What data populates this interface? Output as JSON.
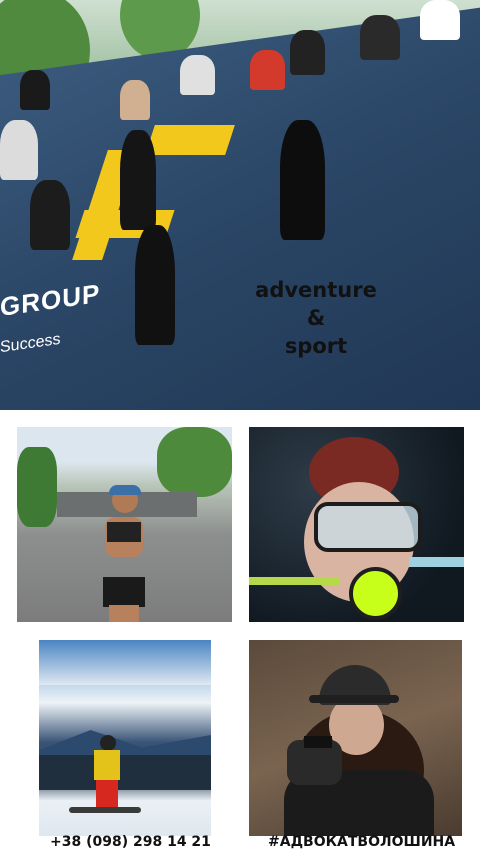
{
  "hero": {
    "banner_text": "GROUP",
    "banner_sub": "Success",
    "overlay": {
      "line1": "adventure",
      "line2": "&",
      "line3": "sport"
    }
  },
  "footer": {
    "phone": "+38 (098) 298 14 21",
    "hashtag": "#АДВОКАТВОЛОШИНА"
  }
}
